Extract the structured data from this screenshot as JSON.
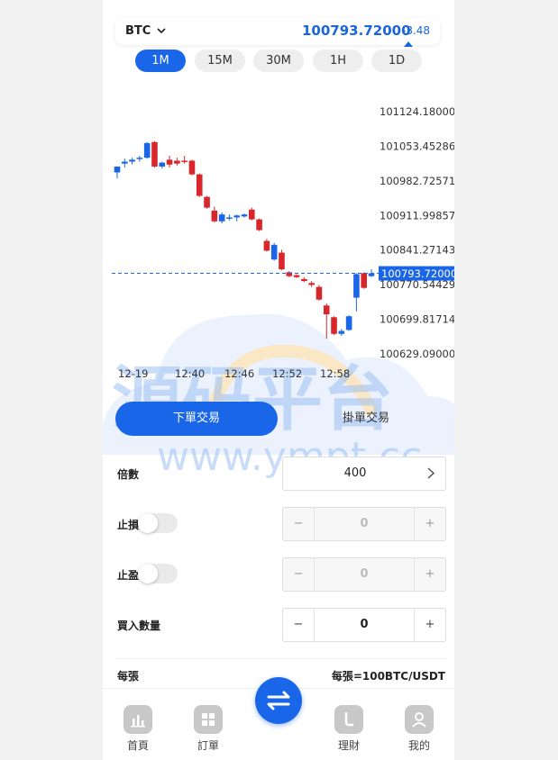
{
  "header": {
    "symbol": "BTC",
    "price": "100793.72000",
    "change": "-3.48"
  },
  "intervals": [
    {
      "label": "1M",
      "active": true
    },
    {
      "label": "15M",
      "active": false
    },
    {
      "label": "30M",
      "active": false
    },
    {
      "label": "1H",
      "active": false
    },
    {
      "label": "1D",
      "active": false
    }
  ],
  "chart_data": {
    "type": "candlestick",
    "y_ticks": [
      "101124.18000",
      "101053.45286",
      "100982.72571",
      "100911.99857",
      "100841.27143",
      "100770.54429",
      "100699.81714",
      "100629.09000"
    ],
    "x_ticks": [
      "12-19",
      "12:40",
      "12:46",
      "12:52",
      "12:58"
    ],
    "current_price_label": "100793.72000",
    "ylim": [
      100629.09,
      101124.18
    ],
    "colors": {
      "up": "#1a66e8",
      "down": "#d9262b"
    },
    "candles": [
      {
        "o": 101000,
        "h": 101012,
        "l": 100988,
        "c": 101012
      },
      {
        "o": 101018,
        "h": 101028,
        "l": 101010,
        "c": 101022
      },
      {
        "o": 101022,
        "h": 101030,
        "l": 101016,
        "c": 101026
      },
      {
        "o": 101028,
        "h": 101034,
        "l": 101022,
        "c": 101030
      },
      {
        "o": 101030,
        "h": 101062,
        "l": 101028,
        "c": 101060
      },
      {
        "o": 101062,
        "h": 101064,
        "l": 101010,
        "c": 101012
      },
      {
        "o": 101012,
        "h": 101022,
        "l": 101008,
        "c": 101020
      },
      {
        "o": 101026,
        "h": 101034,
        "l": 101010,
        "c": 101016
      },
      {
        "o": 101024,
        "h": 101030,
        "l": 101014,
        "c": 101018
      },
      {
        "o": 101024,
        "h": 101034,
        "l": 101018,
        "c": 101022
      },
      {
        "o": 101024,
        "h": 101026,
        "l": 100994,
        "c": 100996
      },
      {
        "o": 100996,
        "h": 100998,
        "l": 100950,
        "c": 100952
      },
      {
        "o": 100950,
        "h": 100952,
        "l": 100926,
        "c": 100928
      },
      {
        "o": 100922,
        "h": 100930,
        "l": 100898,
        "c": 100900
      },
      {
        "o": 100900,
        "h": 100918,
        "l": 100896,
        "c": 100914
      },
      {
        "o": 100906,
        "h": 100914,
        "l": 100902,
        "c": 100908
      },
      {
        "o": 100908,
        "h": 100914,
        "l": 100900,
        "c": 100912
      },
      {
        "o": 100910,
        "h": 100916,
        "l": 100908,
        "c": 100914
      },
      {
        "o": 100924,
        "h": 100928,
        "l": 100902,
        "c": 100904
      },
      {
        "o": 100904,
        "h": 100906,
        "l": 100880,
        "c": 100882
      },
      {
        "o": 100860,
        "h": 100864,
        "l": 100838,
        "c": 100840
      },
      {
        "o": 100822,
        "h": 100856,
        "l": 100820,
        "c": 100852
      },
      {
        "o": 100836,
        "h": 100842,
        "l": 100800,
        "c": 100802
      },
      {
        "o": 100796,
        "h": 100798,
        "l": 100786,
        "c": 100788
      },
      {
        "o": 100790,
        "h": 100792,
        "l": 100784,
        "c": 100786
      },
      {
        "o": 100782,
        "h": 100786,
        "l": 100776,
        "c": 100778
      },
      {
        "o": 100774,
        "h": 100778,
        "l": 100766,
        "c": 100770
      },
      {
        "o": 100766,
        "h": 100770,
        "l": 100738,
        "c": 100740
      },
      {
        "o": 100728,
        "h": 100732,
        "l": 100660,
        "c": 100710
      },
      {
        "o": 100704,
        "h": 100706,
        "l": 100668,
        "c": 100670
      },
      {
        "o": 100670,
        "h": 100680,
        "l": 100666,
        "c": 100676
      },
      {
        "o": 100678,
        "h": 100708,
        "l": 100676,
        "c": 100706
      },
      {
        "o": 100744,
        "h": 100794,
        "l": 100716,
        "c": 100792
      },
      {
        "o": 100794,
        "h": 100796,
        "l": 100762,
        "c": 100764
      },
      {
        "o": 100788,
        "h": 100802,
        "l": 100786,
        "c": 100793.72
      }
    ]
  },
  "tabs": {
    "market": "下單交易",
    "limit": "掛單交易"
  },
  "form": {
    "leverage_label": "倍數",
    "leverage_value": "400",
    "stop_loss_label": "止損",
    "stop_loss_value": "0",
    "take_profit_label": "止盈",
    "take_profit_value": "0",
    "quantity_label": "買入數量",
    "quantity_value": "0",
    "minus": "−",
    "plus": "+"
  },
  "per_lot": {
    "label": "每張",
    "value": "每張=100BTC/USDT"
  },
  "nav": [
    {
      "label": "首頁"
    },
    {
      "label": "訂單"
    },
    {
      "label": "理財"
    },
    {
      "label": "我的"
    }
  ],
  "watermark": {
    "title": "源码平台",
    "url": "www.ympt.cc"
  }
}
